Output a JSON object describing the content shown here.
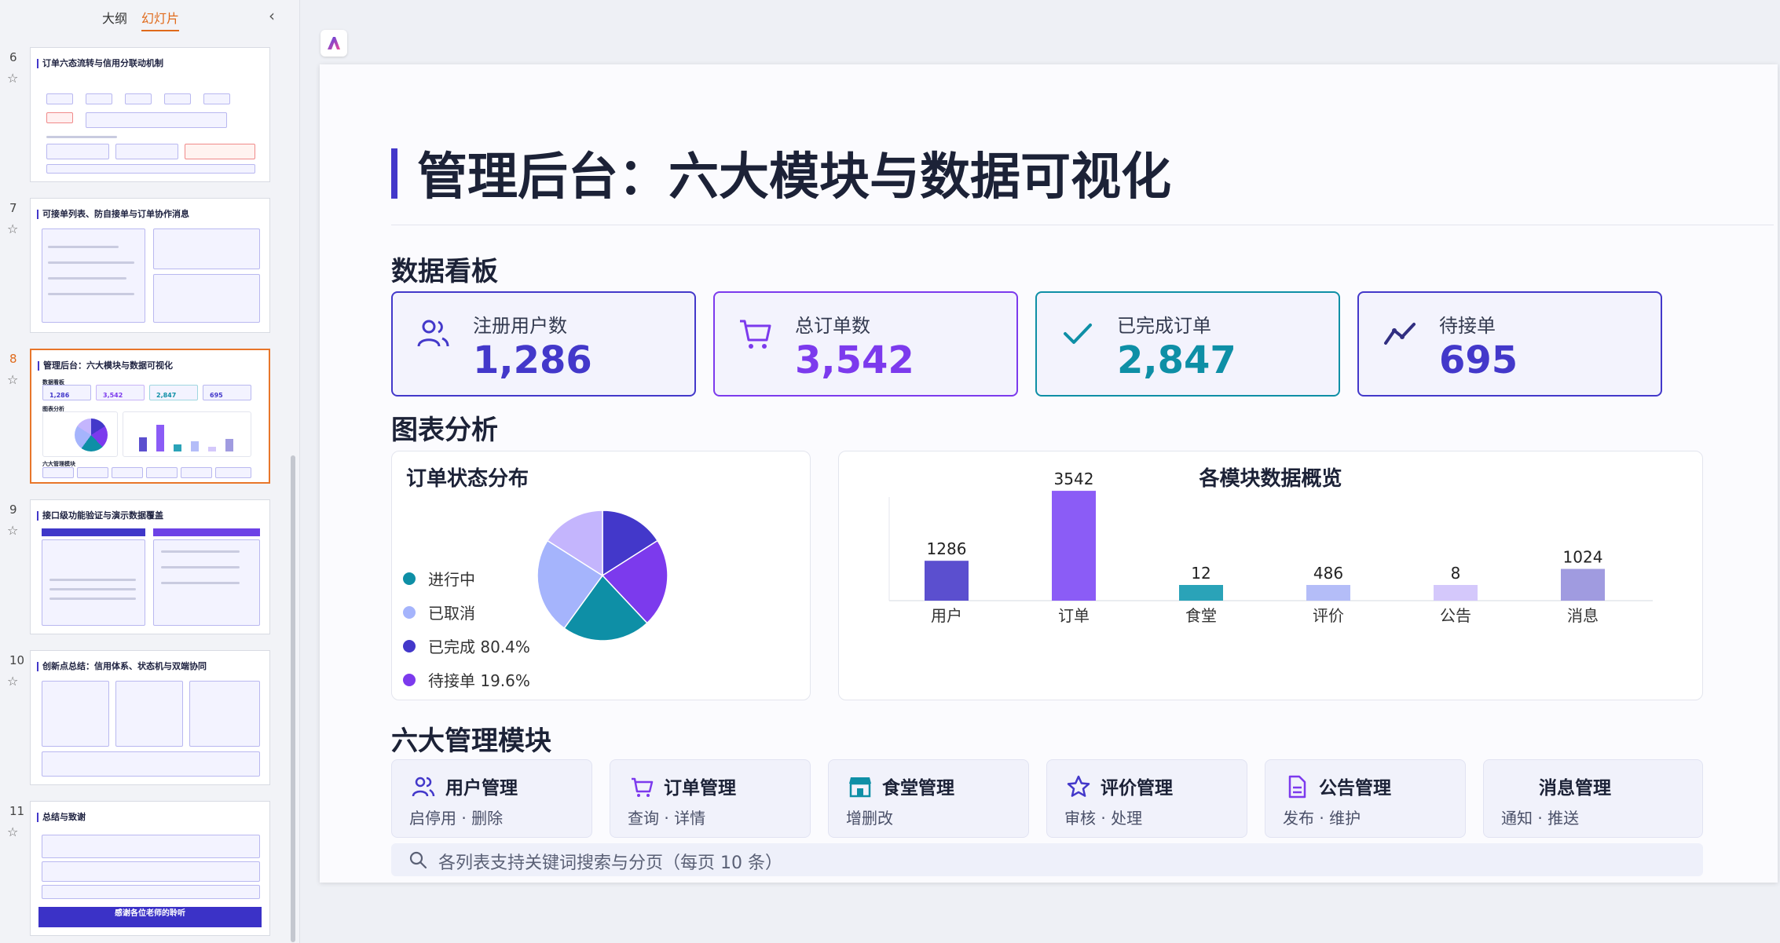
{
  "sidebar": {
    "tabs": [
      {
        "label": "大纲"
      },
      {
        "label": "幻灯片"
      }
    ],
    "collapse_icon": "‹",
    "slides": [
      {
        "number": "6",
        "title": "订单六态流转与信用分联动机制"
      },
      {
        "number": "7",
        "title": "可接单列表、防自接单与订单协作消息"
      },
      {
        "number": "8",
        "title": "管理后台：六大模块与数据可视化",
        "mini_stats": [
          "1,286",
          "3,542",
          "2,847",
          "695"
        ],
        "mini_sections": [
          "数据看板",
          "图表分析",
          "六大管理模块"
        ]
      },
      {
        "number": "9",
        "title": "接口级功能验证与演示数据覆盖"
      },
      {
        "number": "10",
        "title": "创新点总结：信用体系、状态机与双端协同"
      },
      {
        "number": "11",
        "title": "总结与致谢",
        "footer": "感谢各位老师的聆听"
      }
    ]
  },
  "slide": {
    "title": "管理后台：六大模块与数据可视化",
    "dashboard": {
      "heading": "数据看板",
      "cards": [
        {
          "label": "注册用户数",
          "value": "1,286",
          "icon": "users-icon",
          "color": "#4338ca"
        },
        {
          "label": "总订单数",
          "value": "3,542",
          "icon": "cart-icon",
          "color": "#7c3aed"
        },
        {
          "label": "已完成订单",
          "value": "2,847",
          "icon": "check-icon",
          "color": "#0e8fa6"
        },
        {
          "label": "待接单",
          "value": "695",
          "icon": "trend-icon",
          "color": "#4338ca"
        }
      ]
    },
    "charts_heading": "图表分析",
    "modules_heading": "六大管理模块",
    "modules": [
      {
        "name": "用户管理",
        "desc": "启停用 · 删除",
        "icon": "users-icon"
      },
      {
        "name": "订单管理",
        "desc": "查询 · 详情",
        "icon": "cart-icon"
      },
      {
        "name": "食堂管理",
        "desc": "增删改",
        "icon": "store-icon"
      },
      {
        "name": "评价管理",
        "desc": "审核 · 处理",
        "icon": "star-icon"
      },
      {
        "name": "公告管理",
        "desc": "发布 · 维护",
        "icon": "document-icon"
      },
      {
        "name": "消息管理",
        "desc": "通知 · 推送",
        "icon": "message-icon"
      }
    ],
    "search_note": "各列表支持关键词搜索与分页（每页 10 条）"
  },
  "chart_data": [
    {
      "type": "pie",
      "title": "订单状态分布",
      "legend": [
        {
          "label": "进行中",
          "color": "#0e8fa6"
        },
        {
          "label": "已取消",
          "color": "#a5b4fc"
        },
        {
          "label": "已完成 80.4%",
          "color": "#4338ca"
        },
        {
          "label": "待接单 19.6%",
          "color": "#7c3aed"
        }
      ],
      "slices": [
        {
          "name": "已完成",
          "value": 80.4,
          "color": "#4338ca"
        },
        {
          "name": "待接单",
          "value": 19.6,
          "color": "#7c3aed"
        }
      ],
      "render_note": "slices as drawn",
      "drawn_slices": [
        {
          "color": "#4338ca",
          "value": 16
        },
        {
          "color": "#7c3aed",
          "value": 22
        },
        {
          "color": "#0e8fa6",
          "value": 22
        },
        {
          "color": "#a5b4fc",
          "value": 24
        },
        {
          "color": "#c4b5fd",
          "value": 16
        }
      ]
    },
    {
      "type": "bar",
      "title": "各模块数据概览",
      "categories": [
        "用户",
        "订单",
        "食堂",
        "评价",
        "公告",
        "消息"
      ],
      "values": [
        1286,
        3542,
        12,
        486,
        8,
        1024
      ],
      "colors": [
        "#5b4fcf",
        "#8b5cf6",
        "#2aa3b8",
        "#b4bdf8",
        "#d4c8fb",
        "#a09be0"
      ],
      "ylim": [
        0,
        4000
      ]
    }
  ]
}
